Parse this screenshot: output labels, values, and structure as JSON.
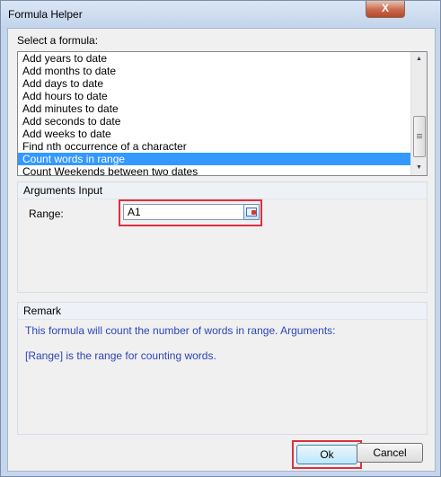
{
  "window": {
    "title": "Formula Helper",
    "close_label": "X"
  },
  "formula_list": {
    "label": "Select a formula:",
    "items": [
      "Add years to date",
      "Add months to date",
      "Add days to date",
      "Add hours to date",
      "Add minutes to date",
      "Add seconds to date",
      "Add weeks to date",
      "Find nth occurrence of a character",
      "Count words in range",
      "Count Weekends between two dates"
    ],
    "selected": "Count words in range",
    "scroll_up_glyph": "▲",
    "scroll_down_glyph": "▼"
  },
  "arguments": {
    "title": "Arguments Input",
    "range_label": "Range:",
    "range_value": "A1",
    "picker_icon": "range-select-icon"
  },
  "remark": {
    "title": "Remark",
    "line1": "This formula will count the number of words in range. Arguments:",
    "line2": "[Range] is the range for counting words."
  },
  "buttons": {
    "ok": "Ok",
    "cancel": "Cancel"
  },
  "colors": {
    "selection": "#3399ff",
    "highlight_box": "#e0303e",
    "remark_text": "#2e44b8",
    "dialog_frame": "#c4d5ec"
  }
}
